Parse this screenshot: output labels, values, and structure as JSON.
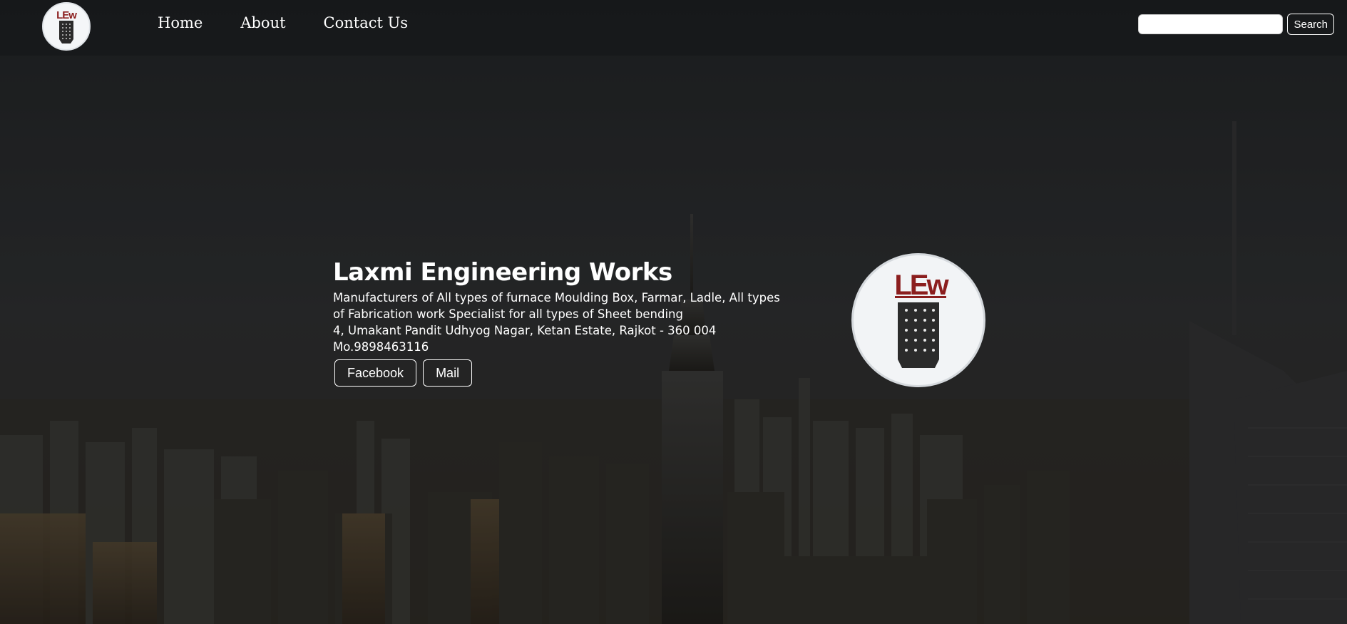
{
  "nav": {
    "logo_text": "LEw",
    "links": [
      {
        "label": "Home"
      },
      {
        "label": "About"
      },
      {
        "label": "Contact Us"
      }
    ],
    "search_placeholder": "",
    "search_button_label": "Search"
  },
  "hero": {
    "title": "Laxmi Engineering Works",
    "description": "Manufacturers of All types of furnace Moulding Box, Farmar, Ladle, All types of Fabrication work Specialist for all types of Sheet bending",
    "address": "4, Umakant Pandit Udhyog Nagar, Ketan Estate, Rajkot - 360 004",
    "phone": "Mo.9898463116",
    "buttons": [
      {
        "label": "Facebook"
      },
      {
        "label": "Mail"
      }
    ],
    "logo_text": "LEw"
  },
  "colors": {
    "logo_red": "#8b1e1e",
    "text": "#ffffff",
    "nav_bg": "rgba(20,22,24,0.55)"
  },
  "icons": {
    "brand_logo": "lew-logo-icon",
    "background": "city-skyline-image"
  }
}
